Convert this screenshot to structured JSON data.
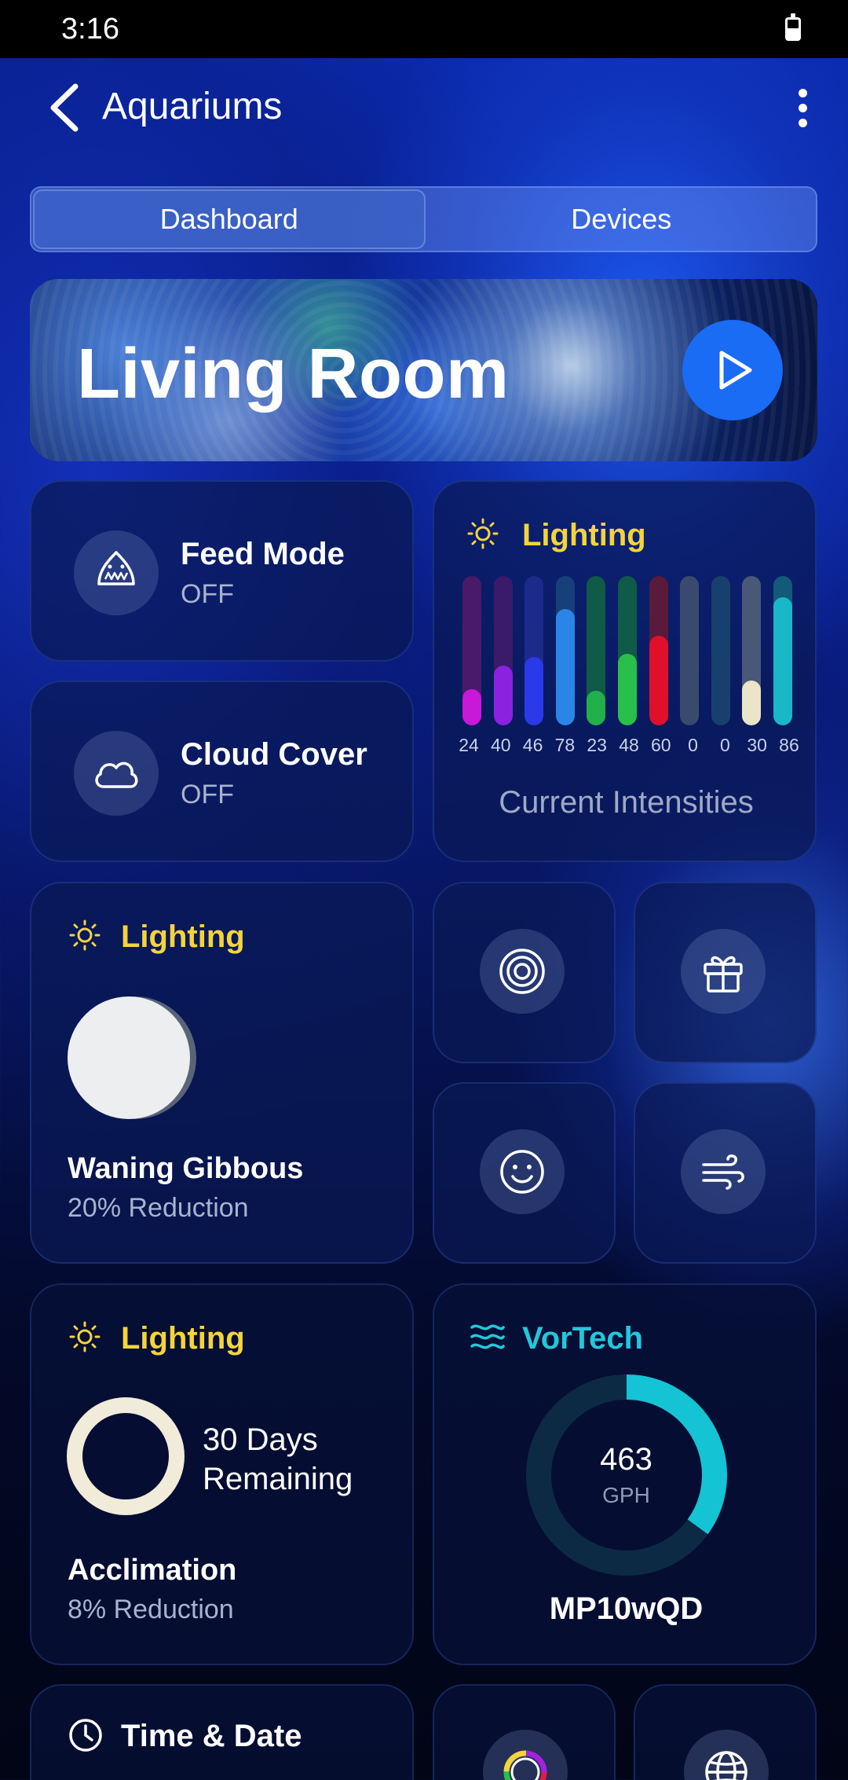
{
  "status_bar": {
    "time": "3:16"
  },
  "header": {
    "title": "Aquariums"
  },
  "tabs": [
    {
      "label": "Dashboard",
      "active": true
    },
    {
      "label": "Devices",
      "active": false
    }
  ],
  "hero": {
    "title": "Living Room"
  },
  "feed_mode": {
    "title": "Feed Mode",
    "status": "OFF",
    "icon": "shark-icon"
  },
  "cloud_cover": {
    "title": "Cloud Cover",
    "status": "OFF",
    "icon": "cloud-icon"
  },
  "intensities": {
    "title": "Lighting",
    "caption": "Current Intensities",
    "channels": [
      {
        "value": 24,
        "label": "24",
        "color": "#c818d8",
        "track": "#4a1a6a"
      },
      {
        "value": 40,
        "label": "40",
        "color": "#8a22e0",
        "track": "#3a1a6a"
      },
      {
        "value": 46,
        "label": "46",
        "color": "#2a3ae8",
        "track": "#1c2a8a"
      },
      {
        "value": 78,
        "label": "78",
        "color": "#2a86e6",
        "track": "#17407a"
      },
      {
        "value": 23,
        "label": "23",
        "color": "#22b04a",
        "track": "#105a48"
      },
      {
        "value": 48,
        "label": "48",
        "color": "#28c04a",
        "track": "#105a48"
      },
      {
        "value": 60,
        "label": "60",
        "color": "#e0102a",
        "track": "#5a1a3a"
      },
      {
        "value": 0,
        "label": "0",
        "color": "#8a9ab8",
        "track": "#3a4a6e"
      },
      {
        "value": 0,
        "label": "0",
        "color": "#2a6aa8",
        "track": "#17406e"
      },
      {
        "value": 30,
        "label": "30",
        "color": "#ebe4c8",
        "track": "#4a5878"
      },
      {
        "value": 86,
        "label": "86",
        "color": "#18b8c8",
        "track": "#135a78"
      }
    ]
  },
  "moon": {
    "title": "Lighting",
    "phase": "Waning Gibbous",
    "reduction": "20% Reduction"
  },
  "quick_tiles": [
    {
      "icon": "target-icon"
    },
    {
      "icon": "gift-icon"
    },
    {
      "icon": "smiley-icon"
    },
    {
      "icon": "wind-icon"
    }
  ],
  "acclimation": {
    "title": "Lighting",
    "days": "30 Days",
    "remaining": "Remaining",
    "name": "Acclimation",
    "reduction": "8% Reduction"
  },
  "vortech": {
    "title": "VorTech",
    "value": "463",
    "unit": "GPH",
    "model": "MP10wQD",
    "ring_fraction": 0.35
  },
  "time_date": {
    "title": "Time & Date"
  },
  "bottom_tiles": [
    {
      "icon": "color-ring-icon"
    },
    {
      "icon": "globe-icon"
    }
  ]
}
